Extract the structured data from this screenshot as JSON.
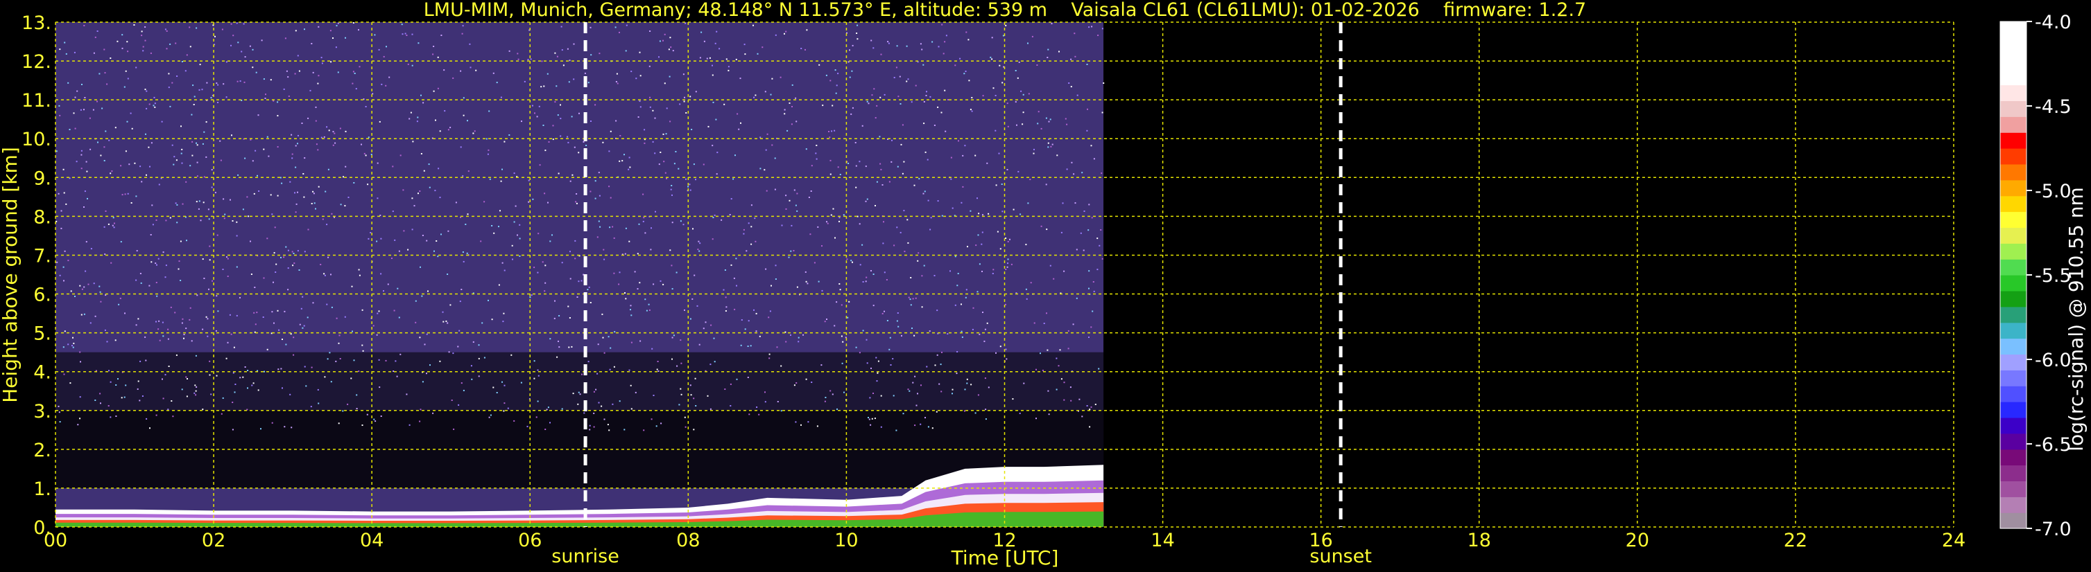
{
  "chart_data": {
    "type": "heatmap",
    "title": "LMU-MIM, Munich, Germany; 48.148° N 11.573° E, altitude: 539 m    Vaisala CL61 (CL61LMU): 01-02-2026    firmware: 1.2.7",
    "xlabel": "Time [UTC]",
    "ylabel": "Height above ground [km]",
    "xlim": [
      0,
      24
    ],
    "ylim": [
      0,
      13
    ],
    "x_ticks": [
      "00",
      "02",
      "04",
      "06",
      "08",
      "10",
      "12",
      "14",
      "16",
      "18",
      "20",
      "22",
      "24"
    ],
    "y_ticks": [
      "0.",
      "1.",
      "2.",
      "3.",
      "4.",
      "5.",
      "6.",
      "7.",
      "8.",
      "9.",
      "10.",
      "11.",
      "12.",
      "13."
    ],
    "grid": true,
    "data_end_time": 13.25,
    "events": [
      {
        "label": "sunrise",
        "time": 6.7
      },
      {
        "label": "sunset",
        "time": 16.25
      }
    ],
    "boundary_layer": {
      "times": [
        0,
        1,
        2,
        3,
        4,
        5,
        6,
        7,
        8,
        8.5,
        9,
        10,
        10.7,
        11,
        11.5,
        12,
        12.5,
        13.25
      ],
      "heights": [
        0.45,
        0.45,
        0.42,
        0.42,
        0.4,
        0.4,
        0.42,
        0.45,
        0.5,
        0.6,
        0.75,
        0.7,
        0.8,
        1.2,
        1.5,
        1.55,
        1.55,
        1.6
      ]
    },
    "colorbar": {
      "label": "log(rc-signal) @ 910.55 nm",
      "range": [
        -7.0,
        -4.0
      ],
      "ticks": [
        "-4.0",
        "-4.5",
        "-5.0",
        "-5.5",
        "-6.0",
        "-6.5",
        "-7.0"
      ],
      "colors": [
        "#a08fa0",
        "#b47fb4",
        "#a050a0",
        "#8c2d8c",
        "#780a78",
        "#5a00a0",
        "#3c00c8",
        "#2828ff",
        "#5050ff",
        "#7878ff",
        "#a0a0ff",
        "#7ac0ff",
        "#3cb4c8",
        "#28a078",
        "#14a014",
        "#28c828",
        "#50dc50",
        "#a0f050",
        "#e6f050",
        "#ffff32",
        "#ffd700",
        "#ffaa00",
        "#ff7800",
        "#ff3c00",
        "#ff0000",
        "#f0a0a0",
        "#f0c8c8",
        "#ffe6e6",
        "#ffffff",
        "#ffffff",
        "#ffffff",
        "#ffffff"
      ]
    }
  }
}
